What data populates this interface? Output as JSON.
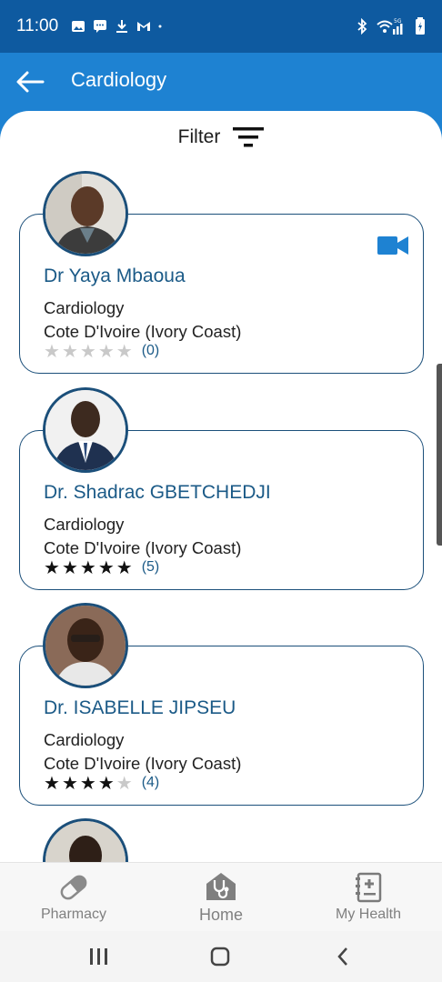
{
  "status_bar": {
    "time": "11:00",
    "left_icons": [
      "image-icon",
      "message-icon",
      "download-icon",
      "gmail-icon",
      "dot-icon"
    ],
    "right_icons": [
      "bluetooth-icon",
      "wifi-5g-icon",
      "battery-icon"
    ],
    "network": "5G"
  },
  "app_bar": {
    "title": "Cardiology",
    "back_icon": "arrow-left-icon",
    "background": "#1e82d2"
  },
  "filter": {
    "label": "Filter",
    "icon": "filter-icon"
  },
  "doctors": [
    {
      "name": "Dr Yaya Mbaoua",
      "specialty": "Cardiology",
      "country": "Cote D'Ivoire (Ivory Coast)",
      "rating": 0,
      "rating_count": "(0)",
      "video_call": true
    },
    {
      "name": "Dr. Shadrac GBETCHEDJI",
      "specialty": "Cardiology",
      "country": "Cote D'Ivoire (Ivory Coast)",
      "rating": 5,
      "rating_count": "(5)",
      "video_call": false
    },
    {
      "name": "Dr. ISABELLE JIPSEU",
      "specialty": "Cardiology",
      "country": "Cote D'Ivoire (Ivory Coast)",
      "rating": 4,
      "rating_count": "(4)",
      "video_call": false
    }
  ],
  "bottom_nav": {
    "items": [
      {
        "label": "Pharmacy",
        "icon": "pill-icon"
      },
      {
        "label": "Home",
        "icon": "stethoscope-icon",
        "active": true
      },
      {
        "label": "My Health",
        "icon": "health-record-icon"
      }
    ]
  },
  "colors": {
    "status_bar": "#0e5aa0",
    "accent": "#1e82d2",
    "doctor_name": "#1b5a87",
    "card_border": "#1b4f7a"
  }
}
